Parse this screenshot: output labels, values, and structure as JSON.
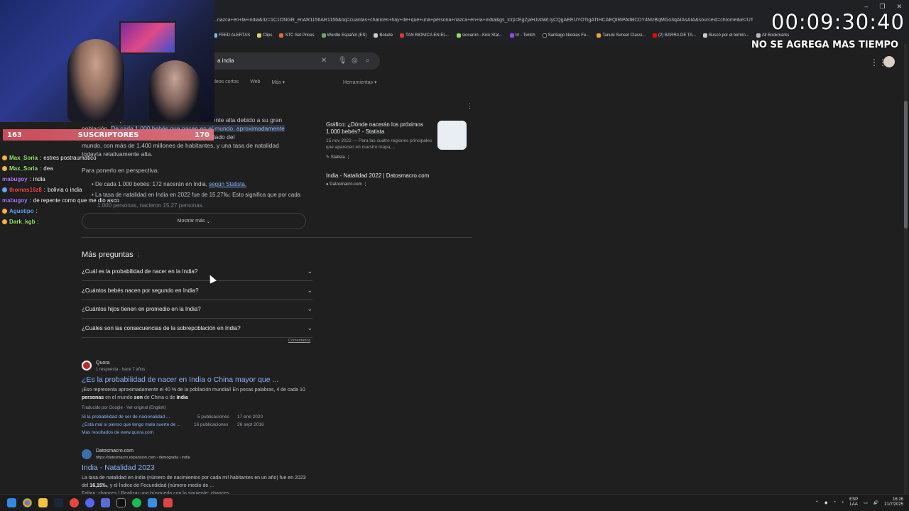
{
  "browser": {
    "url": "...nazca+en+la+india&rlz=1C1ONGR_enAR1156AR1156&oq=cuantas+chances+hay+de+que+una+persona+nazca+en+la+india&gs_lcrp=EgZjaHJvbWUyCQgAEEUYOTigATIHCAEQIRiPAtIBCDY4MzBqMGo3qAIAsAIA&sourceid=chrome&ie=UTF-8",
    "window_controls": [
      "–",
      "❐",
      "✕"
    ],
    "bookmarks": [
      "FEED ALERTAS",
      "Clips",
      "STC Set Prices",
      "Wordle Español (ES)",
      "Bolude",
      "TAN BIONICA EN EL...",
      "sionaron - Kick Stat...",
      "Irr - Twitch",
      "Santiago Nicolas Fe...",
      "Tanuki Sunset Classi...",
      "(2) BARRA DE TA...",
      "Buscó por el termin...",
      "All Bookmarks"
    ]
  },
  "search": {
    "query": "a india",
    "clear_icon": "✕",
    "tabs": [
      "deos cortos",
      "Web",
      "Más ▾"
    ],
    "tools_label": "Herramientas ▾"
  },
  "timer": {
    "value": "00:09:30:40",
    "note": "NO SE AGREGA MAS TIEMPO"
  },
  "stream": {
    "sub_count": "163",
    "sub_label": "SUSCRIPTORES",
    "sub_goal": "170",
    "chat": [
      {
        "user": "Max_Soria",
        "msg": "estres postraumatico",
        "color": "#9cf06a",
        "badge": "#ffb13b"
      },
      {
        "user": "Max_Soria",
        "msg": "dea",
        "color": "#9cf06a",
        "badge": "#ffb13b"
      },
      {
        "user": "mabugoy",
        "msg": "india",
        "color": "#b07cff",
        "badge": ""
      },
      {
        "user": "thomas16z8",
        "msg": "bolivia o india",
        "color": "#ff4a4a",
        "badge": "#5aa8ff"
      },
      {
        "user": "mabugoy",
        "msg": "de repente como que me dio asco",
        "color": "#b07cff",
        "badge": ""
      },
      {
        "user": "Agustipo",
        "msg": "",
        "color": "#6aa8ff",
        "badge": "#ffb13b"
      },
      {
        "user": "Dark_kgb",
        "msg": "",
        "color": "#9cf06a",
        "badge": "#ffb13b"
      }
    ]
  },
  "overview": {
    "line1": "En la India, la probabilidad de nacer es relativamente alta debido a su gran",
    "line2_a": "población. ",
    "line2_hl": "De cada 1.000 bebés que nacen en el mundo, aproximadamente",
    "line3": "172 nacerán en la India. India es el país más poblado del",
    "line4": "mundo, con más de 1.400 millones de habitantes, y una tasa de natalidad",
    "line5": "todavía relativamente alta.",
    "perspective": "Para ponerlo en perspectiva:",
    "bullet1_a": "De cada 1.000 bebés: 172 nacerán en India, ",
    "bullet1_link": "según Statista.",
    "bullet2": "La tasa de natalidad en India en 2022 fue de 15.27‰: Esto significa que por cada",
    "bullet3": "1.000 personas, nacieron 15.27 personas.",
    "show_more": "Mostrar más"
  },
  "side_cards": {
    "card1_title": "Gráfico: ¿Dónde nacerán los próximos 1.000 bebés? - Statista",
    "card1_meta": "15 nov 2022 — Para las cuatro regiones principales que aparecen en nuestro mapa,...",
    "card1_source": "Statista",
    "card2_title": "India - Natalidad 2022 | Datosmacro.com",
    "card2_source": "Datosmacro.com"
  },
  "paa": {
    "title": "Más preguntas",
    "items": [
      "¿Cuál es la probabilidad de nacer en la India?",
      "¿Cuántos bebés nacen por segundo en India?",
      "¿Cuántos hijos tienen en promedio en la India?",
      "¿Cuáles son las consecuencias de la sobrepoblación en India?"
    ],
    "feedback": "Comentarios"
  },
  "results": {
    "quora": {
      "site": "Quora",
      "meta": "1 respuesta · hace 7 años",
      "title": "¿Es la probabilidad de nacer en India o China mayor que ...",
      "snippet_a": "¡Eso representa aproximadamente el 40 % de la población mundial! En pocas palabras, 4 de cada 10 ",
      "snippet_b": "personas",
      "snippet_c": " en el mundo ",
      "snippet_d": "son",
      "snippet_e": " de China o de ",
      "snippet_f": "India",
      "translated": "Traducido por Google · Ver original (English)",
      "sub1": "Si la probabilidad de ser de nacionalidad ...",
      "sub1_count": "5 publicaciones",
      "sub1_date": "17 ene 2020",
      "sub2": "¿Está mal si pienso que tengo mala suerte de ...",
      "sub2_count": "16 publicaciones",
      "sub2_date": "26 sept 2016",
      "more": "Más resultados de www.quora.com"
    },
    "datosmacro": {
      "site": "Datosmacro.com",
      "url": "https://datosmacro.expansion.com › demografia › india",
      "title": "India - Natalidad 2023",
      "snippet1": "La tasa de natalidad en India (número de nacimientos por cada mil habitantes en un año) fue en 2023",
      "snippet2_a": "del ",
      "snippet2_b": "16,15‰",
      "snippet2_c": ", y el Índice de Fecundidad (número medio de ...",
      "snippet3": "Faltan: chances | Realizar una búsqueda con lo siguiente: chances"
    }
  },
  "taskbar": {
    "lang": "ESP",
    "lang2": "LAA",
    "time": "16:26",
    "date": "21/7/2025"
  }
}
